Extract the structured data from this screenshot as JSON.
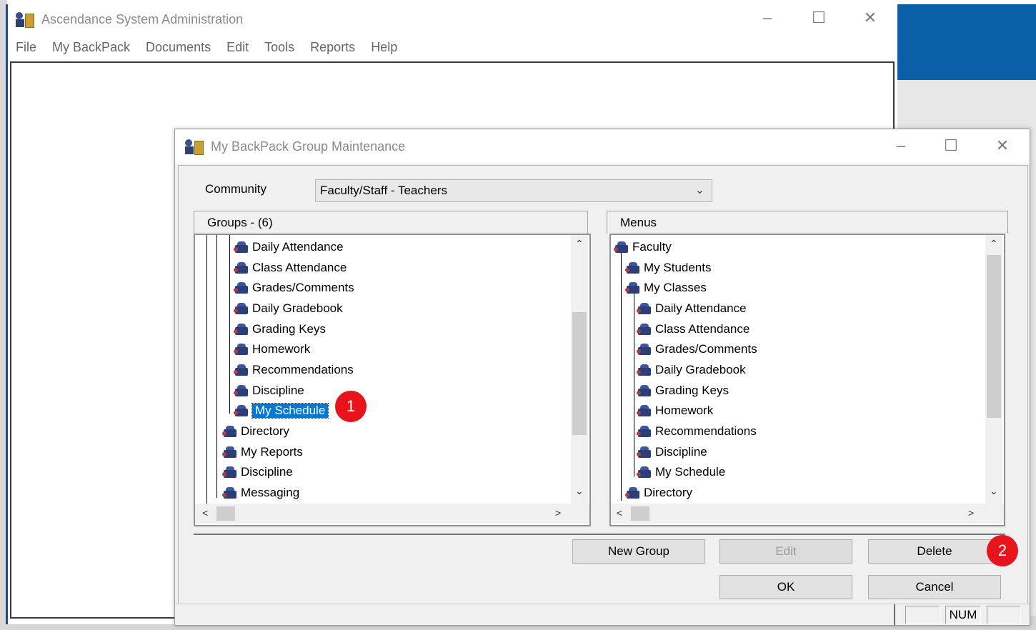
{
  "main": {
    "title": "Ascendance System Administration",
    "controls": {
      "minimize": "–",
      "maximize": "☐",
      "close": "✕"
    },
    "menu": [
      "File",
      "My BackPack",
      "Documents",
      "Edit",
      "Tools",
      "Reports",
      "Help"
    ]
  },
  "dialog": {
    "title": "My BackPack Group Maintenance",
    "controls": {
      "minimize": "–",
      "maximize": "☐",
      "close": "✕"
    },
    "community_label": "Community",
    "community_value": "Faculty/Staff - Teachers",
    "groups_header": "Groups - (6)",
    "menus_header": "Menus",
    "groups_tree": [
      "Daily Attendance",
      "Class Attendance",
      "Grades/Comments",
      "Daily Gradebook",
      "Grading Keys",
      "Homework",
      "Recommendations",
      "Discipline",
      "My Schedule",
      "Directory",
      "My Reports",
      "Discipline",
      "Messaging"
    ],
    "selected_item": "My Schedule",
    "menus_tree": [
      "Faculty",
      "My Students",
      "My Classes",
      "Daily Attendance",
      "Class Attendance",
      "Grades/Comments",
      "Daily Gradebook",
      "Grading Keys",
      "Homework",
      "Recommendations",
      "Discipline",
      "My Schedule",
      "Directory"
    ],
    "buttons": {
      "new_group": "New Group",
      "edit": "Edit",
      "delete": "Delete",
      "ok": "OK",
      "cancel": "Cancel"
    },
    "status": {
      "num": "NUM"
    },
    "badges": {
      "one": "1",
      "two": "2"
    },
    "scroll": {
      "up": "⌃",
      "down": "⌄",
      "left": "<",
      "right": ">"
    }
  },
  "colors": {
    "selection": "#0078d7",
    "badge": "#e8141c",
    "brand_blue": "#0b5fa8"
  }
}
